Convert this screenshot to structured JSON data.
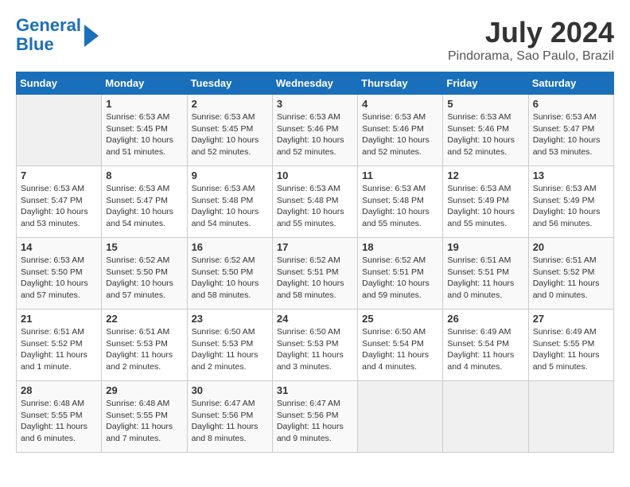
{
  "header": {
    "logo_line1": "General",
    "logo_line2": "Blue",
    "month_year": "July 2024",
    "location": "Pindorama, Sao Paulo, Brazil"
  },
  "days_of_week": [
    "Sunday",
    "Monday",
    "Tuesday",
    "Wednesday",
    "Thursday",
    "Friday",
    "Saturday"
  ],
  "weeks": [
    [
      {
        "day": "",
        "info": ""
      },
      {
        "day": "1",
        "info": "Sunrise: 6:53 AM\nSunset: 5:45 PM\nDaylight: 10 hours\nand 51 minutes."
      },
      {
        "day": "2",
        "info": "Sunrise: 6:53 AM\nSunset: 5:45 PM\nDaylight: 10 hours\nand 52 minutes."
      },
      {
        "day": "3",
        "info": "Sunrise: 6:53 AM\nSunset: 5:46 PM\nDaylight: 10 hours\nand 52 minutes."
      },
      {
        "day": "4",
        "info": "Sunrise: 6:53 AM\nSunset: 5:46 PM\nDaylight: 10 hours\nand 52 minutes."
      },
      {
        "day": "5",
        "info": "Sunrise: 6:53 AM\nSunset: 5:46 PM\nDaylight: 10 hours\nand 52 minutes."
      },
      {
        "day": "6",
        "info": "Sunrise: 6:53 AM\nSunset: 5:47 PM\nDaylight: 10 hours\nand 53 minutes."
      }
    ],
    [
      {
        "day": "7",
        "info": "Sunrise: 6:53 AM\nSunset: 5:47 PM\nDaylight: 10 hours\nand 53 minutes."
      },
      {
        "day": "8",
        "info": "Sunrise: 6:53 AM\nSunset: 5:47 PM\nDaylight: 10 hours\nand 54 minutes."
      },
      {
        "day": "9",
        "info": "Sunrise: 6:53 AM\nSunset: 5:48 PM\nDaylight: 10 hours\nand 54 minutes."
      },
      {
        "day": "10",
        "info": "Sunrise: 6:53 AM\nSunset: 5:48 PM\nDaylight: 10 hours\nand 55 minutes."
      },
      {
        "day": "11",
        "info": "Sunrise: 6:53 AM\nSunset: 5:48 PM\nDaylight: 10 hours\nand 55 minutes."
      },
      {
        "day": "12",
        "info": "Sunrise: 6:53 AM\nSunset: 5:49 PM\nDaylight: 10 hours\nand 55 minutes."
      },
      {
        "day": "13",
        "info": "Sunrise: 6:53 AM\nSunset: 5:49 PM\nDaylight: 10 hours\nand 56 minutes."
      }
    ],
    [
      {
        "day": "14",
        "info": "Sunrise: 6:53 AM\nSunset: 5:50 PM\nDaylight: 10 hours\nand 57 minutes."
      },
      {
        "day": "15",
        "info": "Sunrise: 6:52 AM\nSunset: 5:50 PM\nDaylight: 10 hours\nand 57 minutes."
      },
      {
        "day": "16",
        "info": "Sunrise: 6:52 AM\nSunset: 5:50 PM\nDaylight: 10 hours\nand 58 minutes."
      },
      {
        "day": "17",
        "info": "Sunrise: 6:52 AM\nSunset: 5:51 PM\nDaylight: 10 hours\nand 58 minutes."
      },
      {
        "day": "18",
        "info": "Sunrise: 6:52 AM\nSunset: 5:51 PM\nDaylight: 10 hours\nand 59 minutes."
      },
      {
        "day": "19",
        "info": "Sunrise: 6:51 AM\nSunset: 5:51 PM\nDaylight: 11 hours\nand 0 minutes."
      },
      {
        "day": "20",
        "info": "Sunrise: 6:51 AM\nSunset: 5:52 PM\nDaylight: 11 hours\nand 0 minutes."
      }
    ],
    [
      {
        "day": "21",
        "info": "Sunrise: 6:51 AM\nSunset: 5:52 PM\nDaylight: 11 hours\nand 1 minute."
      },
      {
        "day": "22",
        "info": "Sunrise: 6:51 AM\nSunset: 5:53 PM\nDaylight: 11 hours\nand 2 minutes."
      },
      {
        "day": "23",
        "info": "Sunrise: 6:50 AM\nSunset: 5:53 PM\nDaylight: 11 hours\nand 2 minutes."
      },
      {
        "day": "24",
        "info": "Sunrise: 6:50 AM\nSunset: 5:53 PM\nDaylight: 11 hours\nand 3 minutes."
      },
      {
        "day": "25",
        "info": "Sunrise: 6:50 AM\nSunset: 5:54 PM\nDaylight: 11 hours\nand 4 minutes."
      },
      {
        "day": "26",
        "info": "Sunrise: 6:49 AM\nSunset: 5:54 PM\nDaylight: 11 hours\nand 4 minutes."
      },
      {
        "day": "27",
        "info": "Sunrise: 6:49 AM\nSunset: 5:55 PM\nDaylight: 11 hours\nand 5 minutes."
      }
    ],
    [
      {
        "day": "28",
        "info": "Sunrise: 6:48 AM\nSunset: 5:55 PM\nDaylight: 11 hours\nand 6 minutes."
      },
      {
        "day": "29",
        "info": "Sunrise: 6:48 AM\nSunset: 5:55 PM\nDaylight: 11 hours\nand 7 minutes."
      },
      {
        "day": "30",
        "info": "Sunrise: 6:47 AM\nSunset: 5:56 PM\nDaylight: 11 hours\nand 8 minutes."
      },
      {
        "day": "31",
        "info": "Sunrise: 6:47 AM\nSunset: 5:56 PM\nDaylight: 11 hours\nand 9 minutes."
      },
      {
        "day": "",
        "info": ""
      },
      {
        "day": "",
        "info": ""
      },
      {
        "day": "",
        "info": ""
      }
    ]
  ]
}
